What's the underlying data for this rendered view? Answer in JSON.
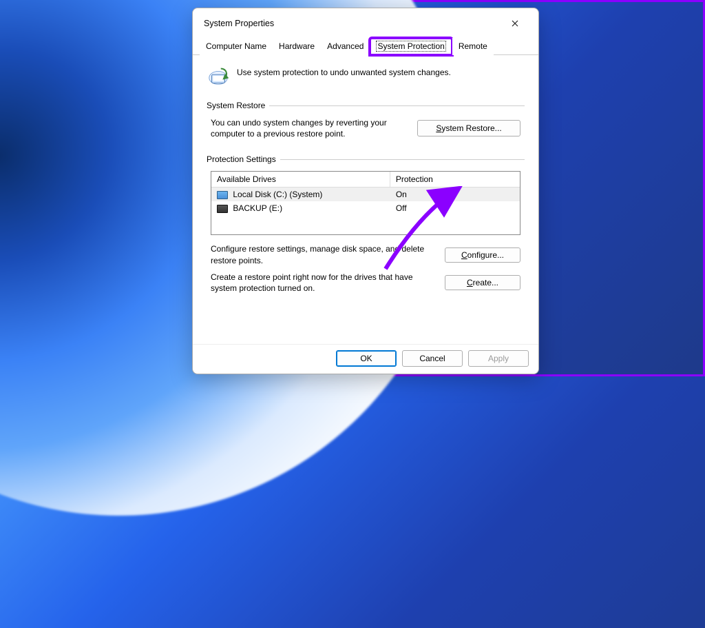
{
  "window": {
    "title": "System Properties"
  },
  "tabs": {
    "computer_name": "Computer Name",
    "hardware": "Hardware",
    "advanced": "Advanced",
    "system_protection": "System Protection",
    "remote": "Remote"
  },
  "intro": "Use system protection to undo unwanted system changes.",
  "groups": {
    "system_restore": "System Restore",
    "protection_settings": "Protection Settings"
  },
  "restore": {
    "text": "You can undo system changes by reverting your computer to a previous restore point.",
    "button_prefix": "S",
    "button_rest": "ystem Restore..."
  },
  "drives": {
    "header_drives": "Available Drives",
    "header_protection": "Protection",
    "rows": [
      {
        "name": "Local Disk (C:) (System)",
        "protection": "On"
      },
      {
        "name": "BACKUP (E:)",
        "protection": "Off"
      }
    ]
  },
  "configure": {
    "text": "Configure restore settings, manage disk space, and delete restore points.",
    "button_prefix": "C",
    "button_rest": "onfigure..."
  },
  "create": {
    "text": "Create a restore point right now for the drives that have system protection turned on.",
    "button_prefix": "C",
    "button_rest": "reate..."
  },
  "footer": {
    "ok": "OK",
    "cancel": "Cancel",
    "apply": "Apply"
  }
}
